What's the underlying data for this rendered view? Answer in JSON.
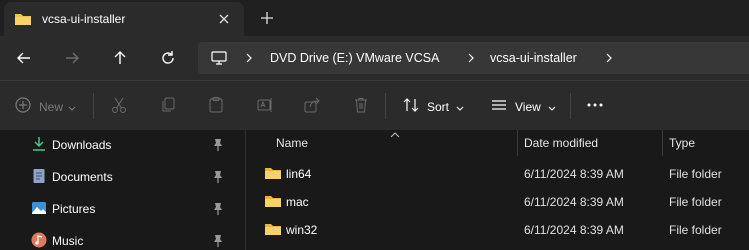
{
  "window": {
    "tab_title": "vcsa-ui-installer"
  },
  "address_bar": {
    "crumbs": [
      "DVD Drive (E:) VMware VCSA",
      "vcsa-ui-installer"
    ]
  },
  "toolbar": {
    "new_label": "New",
    "sort_label": "Sort",
    "view_label": "View"
  },
  "nav_pane": {
    "items": [
      {
        "label": "Downloads",
        "icon": "download-icon"
      },
      {
        "label": "Documents",
        "icon": "documents-icon"
      },
      {
        "label": "Pictures",
        "icon": "pictures-icon"
      },
      {
        "label": "Music",
        "icon": "music-icon"
      }
    ]
  },
  "file_list": {
    "columns": [
      "Name",
      "Date modified",
      "Type"
    ],
    "rows": [
      {
        "name": "lin64",
        "date": "6/11/2024 8:39 AM",
        "type": "File folder"
      },
      {
        "name": "mac",
        "date": "6/11/2024 8:39 AM",
        "type": "File folder"
      },
      {
        "name": "win32",
        "date": "6/11/2024 8:39 AM",
        "type": "File folder"
      }
    ]
  },
  "colors": {
    "folder": "#f2c14e",
    "background": "#191919",
    "chrome": "#2b2b2b",
    "accent_green": "#4cc38a"
  }
}
